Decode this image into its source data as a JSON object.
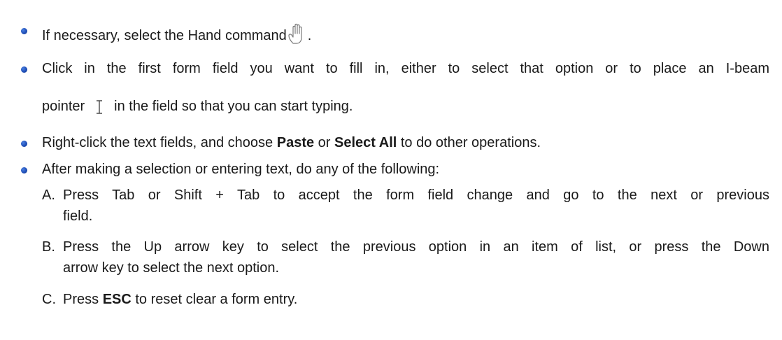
{
  "items": [
    {
      "pre": "If necessary, select the Hand command",
      "post": ".",
      "icon": "hand-icon"
    },
    {
      "line1": "Click in the first form field you want to fill in, either to select that option or to place an I-beam",
      "line2_pre": "pointer",
      "icon": "i-beam-pointer-icon",
      "line2_post": "in the field so that you can start typing."
    },
    {
      "t1": "Right-click the text fields, and choose ",
      "b1": "Paste",
      "t2": " or ",
      "b2": "Select All",
      "t3": " to do other operations."
    },
    {
      "text": "After making a selection or entering text, do any of the following:"
    }
  ],
  "sub_items": [
    {
      "letter": "A.",
      "line1": "Press Tab or Shift + Tab to accept the form field change and go to the next or previous",
      "line2": "field."
    },
    {
      "letter": "B.",
      "line1": "Press the Up arrow key to select the previous option in an item of list, or press the Down",
      "line2": "arrow key to select the next option."
    },
    {
      "letter": "C.",
      "t1": "Press ",
      "b1": "ESC",
      "t2": " to reset clear a form entry."
    }
  ]
}
